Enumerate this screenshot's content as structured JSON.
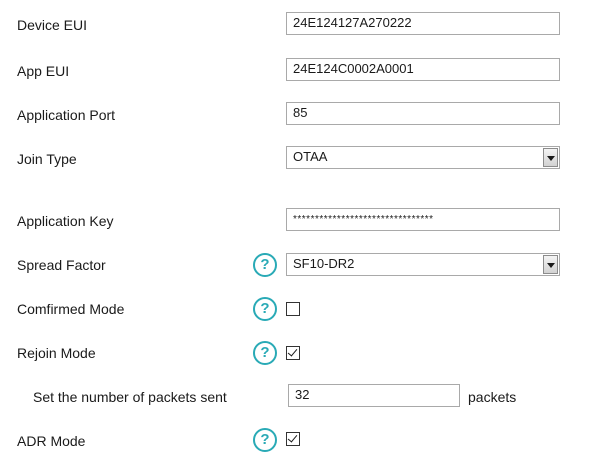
{
  "device_eui": {
    "label": "Device EUI",
    "value": "24E124127A270222"
  },
  "app_eui": {
    "label": "App EUI",
    "value": "24E124C0002A0001"
  },
  "application_port": {
    "label": "Application Port",
    "value": "85"
  },
  "join_type": {
    "label": "Join Type",
    "selected": "OTAA"
  },
  "application_key": {
    "label": "Application Key",
    "value": "********************************"
  },
  "spread_factor": {
    "label": "Spread Factor",
    "selected": "SF10-DR2",
    "help_icon": "?"
  },
  "confirmed_mode": {
    "label": "Comfirmed Mode",
    "checked": false,
    "help_icon": "?"
  },
  "rejoin_mode": {
    "label": "Rejoin Mode",
    "checked": true,
    "help_icon": "?"
  },
  "packets_sent": {
    "label": "Set the number of packets sent",
    "value": "32",
    "unit": "packets"
  },
  "adr_mode": {
    "label": "ADR Mode",
    "checked": true,
    "help_icon": "?"
  },
  "colors": {
    "help_icon": "#29aab6",
    "border": "#a9a9a9",
    "text": "#1a1a1a"
  },
  "icons": {
    "help": "question-circle-icon",
    "select_arrow": "chevron-down-icon",
    "checkbox_checked": "checkmark-icon"
  }
}
